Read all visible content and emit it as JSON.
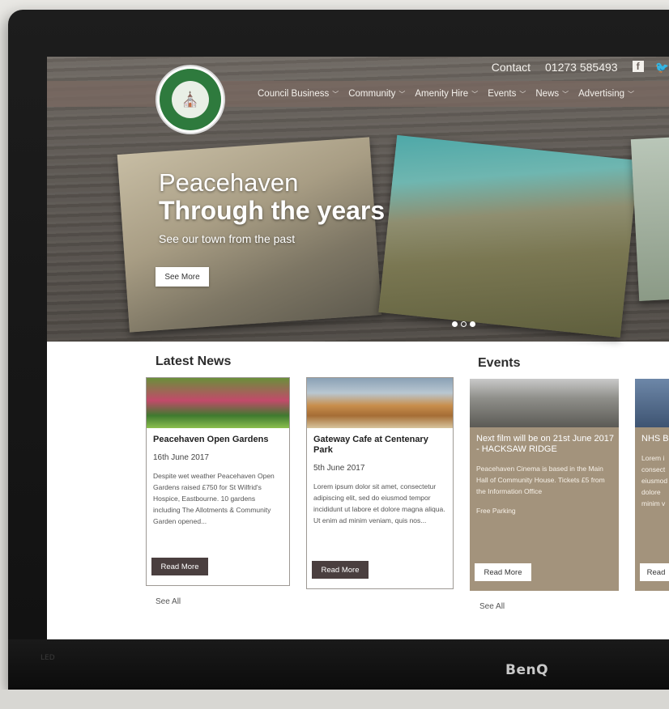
{
  "top": {
    "contact": "Contact",
    "phone": "01273 585493"
  },
  "logo": {
    "text": "PEACEHAVEN TOWN COUNCIL"
  },
  "nav": [
    {
      "label": "Council Business"
    },
    {
      "label": "Community"
    },
    {
      "label": "Amenity Hire"
    },
    {
      "label": "Events"
    },
    {
      "label": "News"
    },
    {
      "label": "Advertising"
    }
  ],
  "hero": {
    "title1": "Peacehaven",
    "title2": "Through the years",
    "subtitle": "See our town from the past",
    "button": "See More",
    "slides": 3,
    "active_slide": 1
  },
  "news": {
    "heading": "Latest News",
    "see_all": "See All",
    "items": [
      {
        "title": "Peacehaven Open Gardens",
        "date": "16th June 2017",
        "body": "Despite wet weather Peacehaven Open Gardens raised £750 for St Wilfrid's Hospice, Eastbourne. 10 gardens including The Allotments & Community Garden opened...",
        "button": "Read More"
      },
      {
        "title": "Gateway Cafe at Centenary Park",
        "date": "5th June 2017",
        "body": "Lorem ipsum dolor sit amet, consectetur adipiscing elit, sed do eiusmod tempor incididunt ut labore et dolore magna aliqua. Ut enim ad minim veniam, quis nos...",
        "button": "Read More"
      }
    ]
  },
  "events": {
    "heading": "Events",
    "see_all": "See All",
    "items": [
      {
        "title": "Next film will be on 21st June 2017 - HACKSAW RIDGE",
        "body": "Peacehaven Cinema is based in the Main Hall of Community House. Tickets £5 from the Information Office",
        "extra": "Free Parking",
        "button": "Read More"
      },
      {
        "title": "NHS B",
        "body": "Lorem i consect eiusmod et dolore minim v",
        "button": "Read"
      }
    ]
  },
  "monitor": {
    "brand": "BenQ",
    "led": "LED"
  },
  "colors": {
    "nav_bar": "#786860",
    "event_card": "#a3937c",
    "button_dark": "#4a3f3f",
    "logo_green": "#2e7a3d"
  }
}
